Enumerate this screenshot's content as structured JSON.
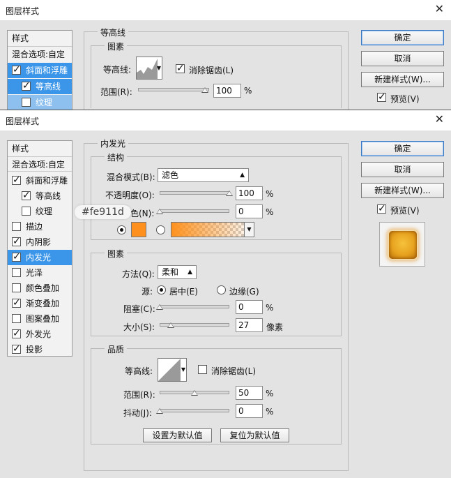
{
  "colors": {
    "accent_selected": "#3b95e8",
    "glow_color": "#fe911d"
  },
  "back_dialog": {
    "title": "图层样式",
    "close_icon": "close-icon",
    "sidebar": {
      "header": "样式",
      "blend_options": "混合选项:自定",
      "items": [
        {
          "label": "斜面和浮雕",
          "checked": true,
          "selected": true
        },
        {
          "label": "等高线",
          "checked": true,
          "selected": true
        },
        {
          "label": "纹理",
          "checked": false,
          "selected": true
        }
      ]
    },
    "panel_title": "等高线",
    "group_label": "图素",
    "contour_label": "等高线:",
    "antialias_label": "消除锯齿(L)",
    "range_label": "范围(R):",
    "range_value": "100",
    "range_unit": "%",
    "buttons": {
      "ok": "确定",
      "cancel": "取消",
      "new_style": "新建样式(W)...",
      "preview": "预览(V)"
    }
  },
  "dialog": {
    "title": "图层样式",
    "close_icon": "close-icon",
    "sidebar": {
      "header": "样式",
      "blend_options": "混合选项:自定",
      "items": [
        {
          "label": "斜面和浮雕",
          "checked": true,
          "selected": false
        },
        {
          "label": "等高线",
          "checked": true,
          "selected": false
        },
        {
          "label": "纹理",
          "checked": false,
          "selected": false
        },
        {
          "label": "描边",
          "checked": false,
          "selected": false
        },
        {
          "label": "内阴影",
          "checked": true,
          "selected": false
        },
        {
          "label": "内发光",
          "checked": true,
          "selected": true
        },
        {
          "label": "光泽",
          "checked": false,
          "selected": false
        },
        {
          "label": "颜色叠加",
          "checked": false,
          "selected": false
        },
        {
          "label": "渐变叠加",
          "checked": true,
          "selected": false
        },
        {
          "label": "图案叠加",
          "checked": false,
          "selected": false
        },
        {
          "label": "外发光",
          "checked": true,
          "selected": false
        },
        {
          "label": "投影",
          "checked": true,
          "selected": false
        }
      ]
    },
    "panel_title": "内发光",
    "structure": {
      "label": "结构",
      "blend_mode_label": "混合模式(B):",
      "blend_mode_value": "滤色",
      "opacity_label": "不透明度(O):",
      "opacity_value": "100",
      "opacity_pct": 100,
      "noise_label": "杂色(N):",
      "noise_value": "0",
      "noise_pct": 0,
      "pct": "%",
      "tooltip": "#fe911d"
    },
    "elements": {
      "label": "图素",
      "method_label": "方法(Q):",
      "method_value": "柔和",
      "source_label": "源:",
      "center_label": "居中(E)",
      "edge_label": "边缘(G)",
      "choke_label": "阻塞(C):",
      "choke_value": "0",
      "choke_pct": 0,
      "size_label": "大小(S):",
      "size_value": "27",
      "size_unit": "像素",
      "pct": "%"
    },
    "quality": {
      "label": "品质",
      "contour_label": "等高线:",
      "antialias_label": "消除锯齿(L)",
      "range_label": "范围(R):",
      "range_value": "50",
      "range_pct": 50,
      "jitter_label": "抖动(J):",
      "jitter_value": "0",
      "jitter_pct": 0,
      "pct": "%"
    },
    "set_default": "设置为默认值",
    "reset_default": "复位为默认值",
    "buttons": {
      "ok": "确定",
      "cancel": "取消",
      "new_style": "新建样式(W)...",
      "preview": "预览(V)"
    }
  }
}
